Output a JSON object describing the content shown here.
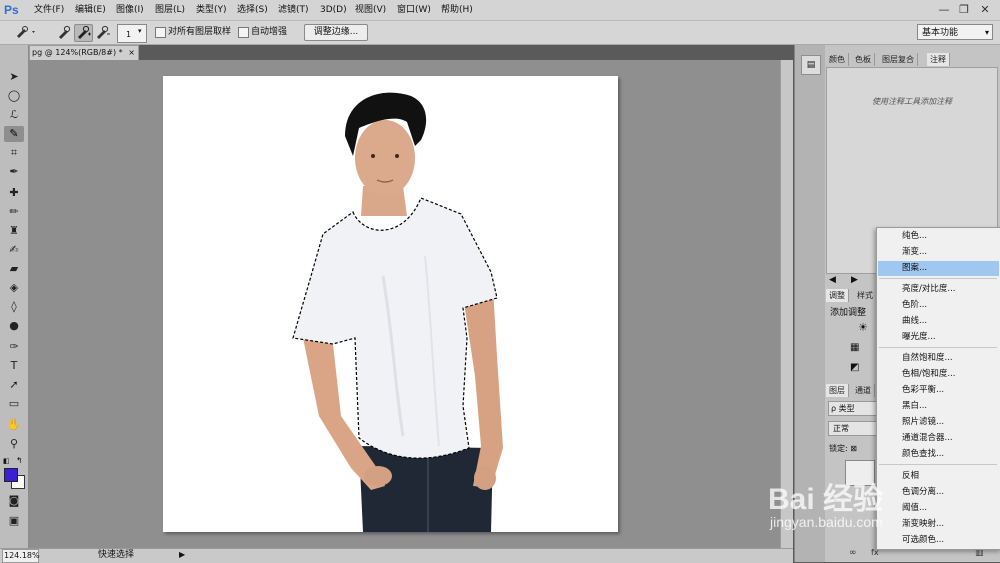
{
  "menubar": {
    "logo": "Ps",
    "items": [
      "文件(F)",
      "编辑(E)",
      "图像(I)",
      "图层(L)",
      "类型(Y)",
      "选择(S)",
      "滤镜(T)",
      "3D(D)",
      "视图(V)",
      "窗口(W)",
      "帮助(H)"
    ],
    "window_controls": [
      "—",
      "❐",
      "✕"
    ]
  },
  "options": {
    "brush_size": "1",
    "sample_all_layers": "对所有图层取样",
    "auto_enhance": "自动增强",
    "refine_edge": "调整边缘...",
    "workspace": "基本功能"
  },
  "document": {
    "tab_title": "pg @ 124%(RGB/8#) *",
    "zoom": "124.18%",
    "status_tool": "快速选择"
  },
  "panels": {
    "top_tabs": [
      "颜色",
      "色板",
      "图层复合",
      "注释"
    ],
    "notes_hint": "使用注释工具添加注释",
    "adjust_tabs": [
      "调整",
      "样式"
    ],
    "add_adjustment": "添加调整",
    "layers_tabs": [
      "图层",
      "通道"
    ],
    "layer_filter": "ρ 类型",
    "blend_mode": "正常",
    "lock_label": "锁定: ⊠"
  },
  "adjustment_menu": {
    "items": [
      "纯色...",
      "渐变...",
      "图案...",
      "亮度/对比度...",
      "色阶...",
      "曲线...",
      "曝光度...",
      "自然饱和度...",
      "色相/饱和度...",
      "色彩平衡...",
      "黑白...",
      "照片滤镜...",
      "通道混合器...",
      "颜色查找...",
      "反相",
      "色调分离...",
      "阈值...",
      "渐变映射...",
      "可选颜色..."
    ],
    "highlighted": "图案..."
  },
  "watermark": {
    "text": "Bai 经验",
    "url": "jingyan.baidu.com"
  },
  "colors": {
    "foreground": "#3a1fd6",
    "background": "#ffffff",
    "highlight": "#9fc7f0"
  }
}
